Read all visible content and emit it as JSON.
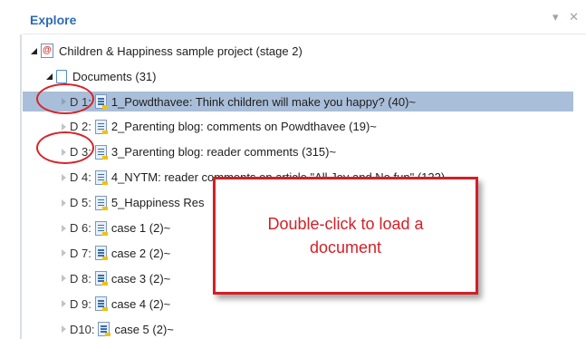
{
  "panel": {
    "title": "Explore",
    "controls": "▾ ✕"
  },
  "tree": {
    "project": {
      "label": "Children & Happiness sample project (stage 2)"
    },
    "folder": {
      "label": "Documents (31)"
    },
    "documents": [
      {
        "id": "D 1:",
        "label": "1_Powdthavee: Think children will make you happy? (40)~",
        "selected": true
      },
      {
        "id": "D 2:",
        "label": "2_Parenting blog: comments on Powdthavee (19)~",
        "selected": false
      },
      {
        "id": "D 3:",
        "label": "3_Parenting blog: reader comments (315)~",
        "selected": false
      },
      {
        "id": "D 4:",
        "label": "4_NYTM: reader comments on article \"All Joy and No fun\" (122)~",
        "selected": false
      },
      {
        "id": "D 5:",
        "label": "5_Happiness Res",
        "selected": false
      },
      {
        "id": "D 6:",
        "label": "case 1 (2)~",
        "selected": false
      },
      {
        "id": "D 7:",
        "label": "case 2 (2)~",
        "selected": false
      },
      {
        "id": "D 8:",
        "label": "case 3 (2)~",
        "selected": false
      },
      {
        "id": "D 9:",
        "label": "case 4 (2)~",
        "selected": false
      },
      {
        "id": "D10:",
        "label": "case 5 (2)~",
        "selected": false
      }
    ]
  },
  "callout": {
    "text": "Double-click to load a document"
  },
  "colors": {
    "accent": "#2d6bb5",
    "selection": "#a9bed9",
    "annotation_red": "#d41f26"
  },
  "icons": {
    "project": "project-icon",
    "folder": "folder-icon",
    "document": "document-icon"
  }
}
